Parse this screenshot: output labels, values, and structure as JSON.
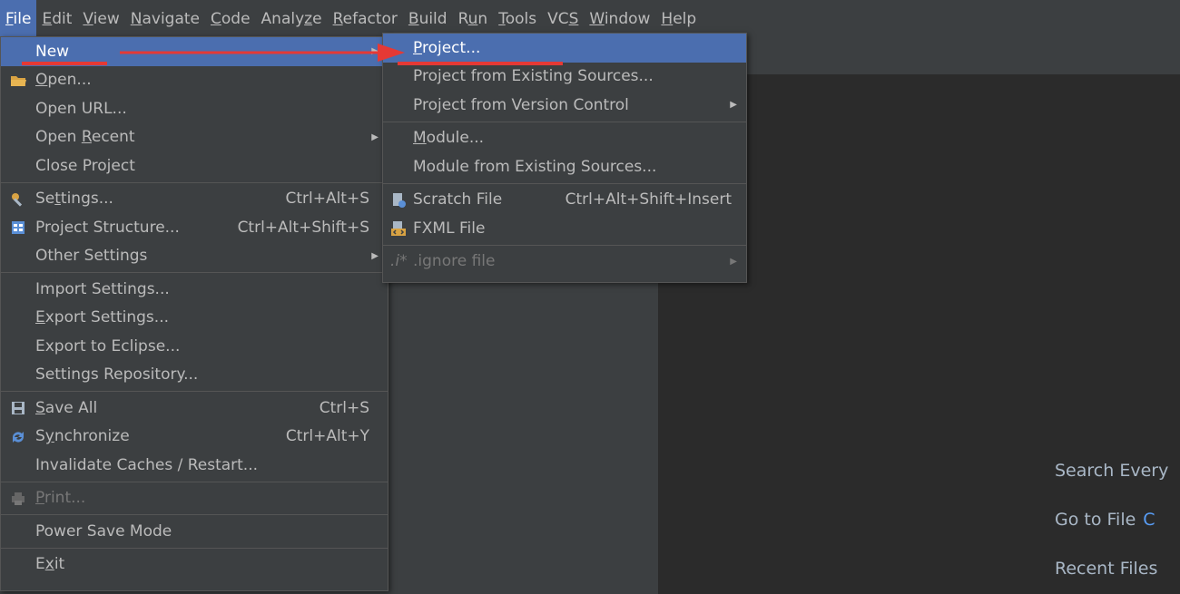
{
  "menubar": [
    {
      "pre": "",
      "u": "F",
      "post": "ile",
      "active": true
    },
    {
      "pre": "",
      "u": "E",
      "post": "dit"
    },
    {
      "pre": "",
      "u": "V",
      "post": "iew"
    },
    {
      "pre": "",
      "u": "N",
      "post": "avigate"
    },
    {
      "pre": "",
      "u": "C",
      "post": "ode"
    },
    {
      "pre": "Analy",
      "u": "z",
      "post": "e"
    },
    {
      "pre": "",
      "u": "R",
      "post": "efactor"
    },
    {
      "pre": "",
      "u": "B",
      "post": "uild"
    },
    {
      "pre": "R",
      "u": "u",
      "post": "n"
    },
    {
      "pre": "",
      "u": "T",
      "post": "ools"
    },
    {
      "pre": "VC",
      "u": "S",
      "post": ""
    },
    {
      "pre": "",
      "u": "W",
      "post": "indow"
    },
    {
      "pre": "",
      "u": "H",
      "post": "elp"
    }
  ],
  "file_menu": {
    "new": "New",
    "open_pre": "",
    "open_u": "O",
    "open_post": "pen...",
    "open_url": "Open URL...",
    "open_recent_pre": "Open ",
    "open_recent_u": "R",
    "open_recent_post": "ecent",
    "close_project": "Close Project",
    "settings_pre": "Se",
    "settings_u": "t",
    "settings_post": "tings...",
    "settings_shortcut": "Ctrl+Alt+S",
    "project_structure": "Project Structure...",
    "project_structure_shortcut": "Ctrl+Alt+Shift+S",
    "other_settings": "Other Settings",
    "import_settings": "Import Settings...",
    "export_settings_pre": "",
    "export_settings_u": "E",
    "export_settings_post": "xport Settings...",
    "export_eclipse": "Export to Eclipse...",
    "settings_repo": "Settings Repository...",
    "save_all_pre": "",
    "save_all_u": "S",
    "save_all_post": "ave All",
    "save_all_shortcut": "Ctrl+S",
    "sync_pre": "S",
    "sync_u": "y",
    "sync_post": "nchronize",
    "sync_shortcut": "Ctrl+Alt+Y",
    "invalidate": "Invalidate Caches / Restart...",
    "print_pre": "",
    "print_u": "P",
    "print_post": "rint...",
    "power_save": "Power Save Mode",
    "exit_pre": "E",
    "exit_u": "x",
    "exit_post": "it"
  },
  "new_menu": {
    "project_pre": "",
    "project_u": "P",
    "project_post": "roject...",
    "project_existing": "Project from Existing Sources...",
    "project_vcs": "Project from Version Control",
    "module_pre": "",
    "module_u": "M",
    "module_post": "odule...",
    "module_existing": "Module from Existing Sources...",
    "scratch": "Scratch File",
    "scratch_shortcut": "Ctrl+Alt+Shift+Insert",
    "fxml": "FXML File",
    "ignore_prefix": ".i*",
    "ignore": ".ignore file"
  },
  "hints": {
    "search": "Search Every",
    "goto": "Go to File",
    "goto_key": "C",
    "recent": "Recent Files"
  },
  "colors": {
    "selection": "#4b6eaf",
    "annotation": "#e53935"
  }
}
